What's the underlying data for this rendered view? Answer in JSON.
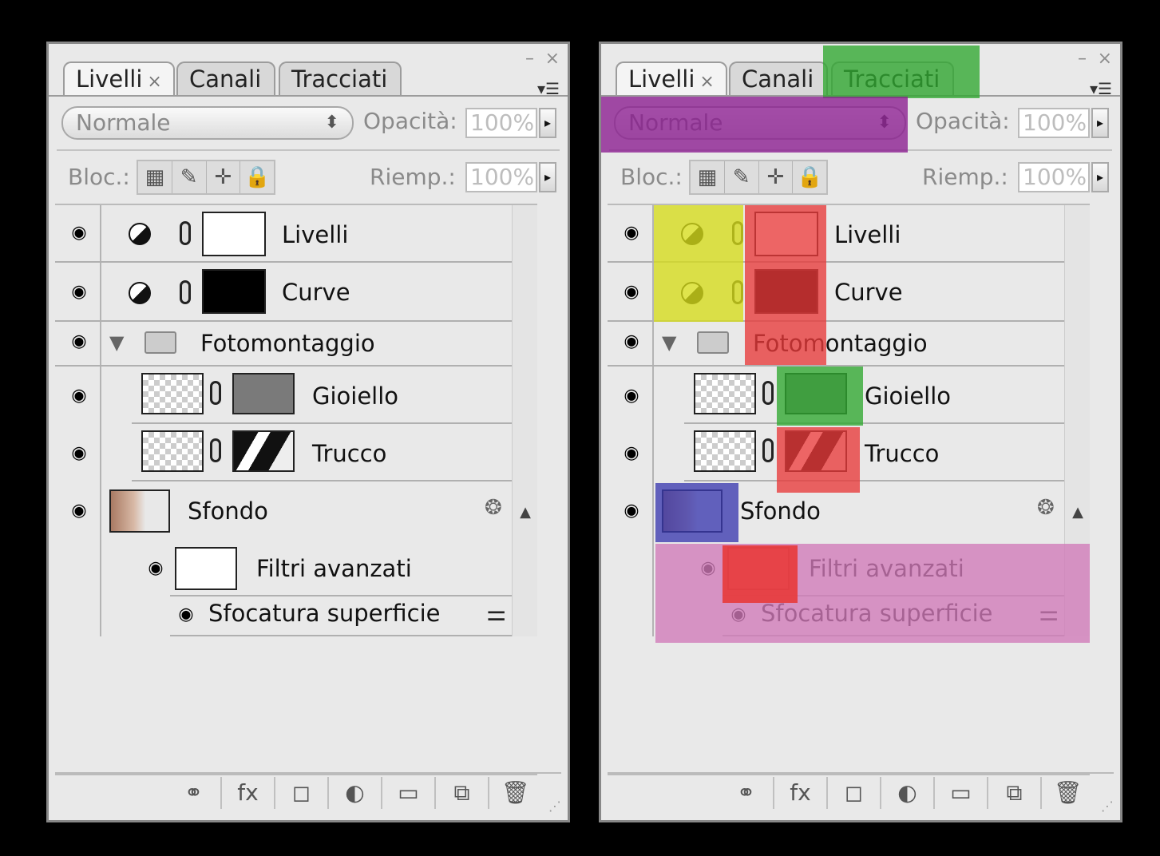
{
  "tabs": [
    {
      "label": "Livelli",
      "close": "×",
      "active": true
    },
    {
      "label": "Canali",
      "close": "",
      "active": false
    },
    {
      "label": "Tracciati",
      "close": "",
      "active": false
    }
  ],
  "window_controls": {
    "minimize": "–",
    "close": "×",
    "menu": "▾☰"
  },
  "blend_mode": {
    "value": "Normale",
    "arrow": "⬍"
  },
  "opacity": {
    "label": "Opacità:",
    "value": "100%",
    "arrow": "▸"
  },
  "lock": {
    "label": "Bloc.:",
    "icons": [
      "lock-transparent-icon",
      "brush-icon",
      "move-icon",
      "lock-icon"
    ],
    "glyphs": [
      "▦",
      "✎",
      "✛",
      "🔒"
    ]
  },
  "fill": {
    "label": "Riemp.:",
    "value": "100%",
    "arrow": "▸"
  },
  "layers": [
    {
      "name": "Livelli",
      "type": "adjustment"
    },
    {
      "name": "Curve",
      "type": "adjustment"
    },
    {
      "name": "Fotomontaggio",
      "type": "group"
    },
    {
      "name": "Gioiello",
      "type": "masked-layer"
    },
    {
      "name": "Trucco",
      "type": "masked-layer"
    },
    {
      "name": "Sfondo",
      "type": "smart-object"
    },
    {
      "name": "Filtri avanzati",
      "type": "smart-filters"
    },
    {
      "name": "Sfocatura superficie",
      "type": "filter"
    }
  ],
  "eye_glyph": "◉",
  "bottom_icons": {
    "names": [
      "link-layers-icon",
      "fx-icon",
      "mask-icon",
      "adjustment-icon",
      "folder-icon",
      "new-layer-icon",
      "trash-icon"
    ],
    "glyphs": [
      "⚭",
      "fx",
      "◻",
      "◐",
      "▭",
      "⧉",
      "🗑"
    ]
  },
  "highlight_colors": {
    "yellow": "#d6dc1a",
    "red": "#e83a3a",
    "green": "#2fa82f",
    "purple": "#8b1b8f",
    "blue": "#3b3ab0",
    "pink": "#d17ab8"
  }
}
